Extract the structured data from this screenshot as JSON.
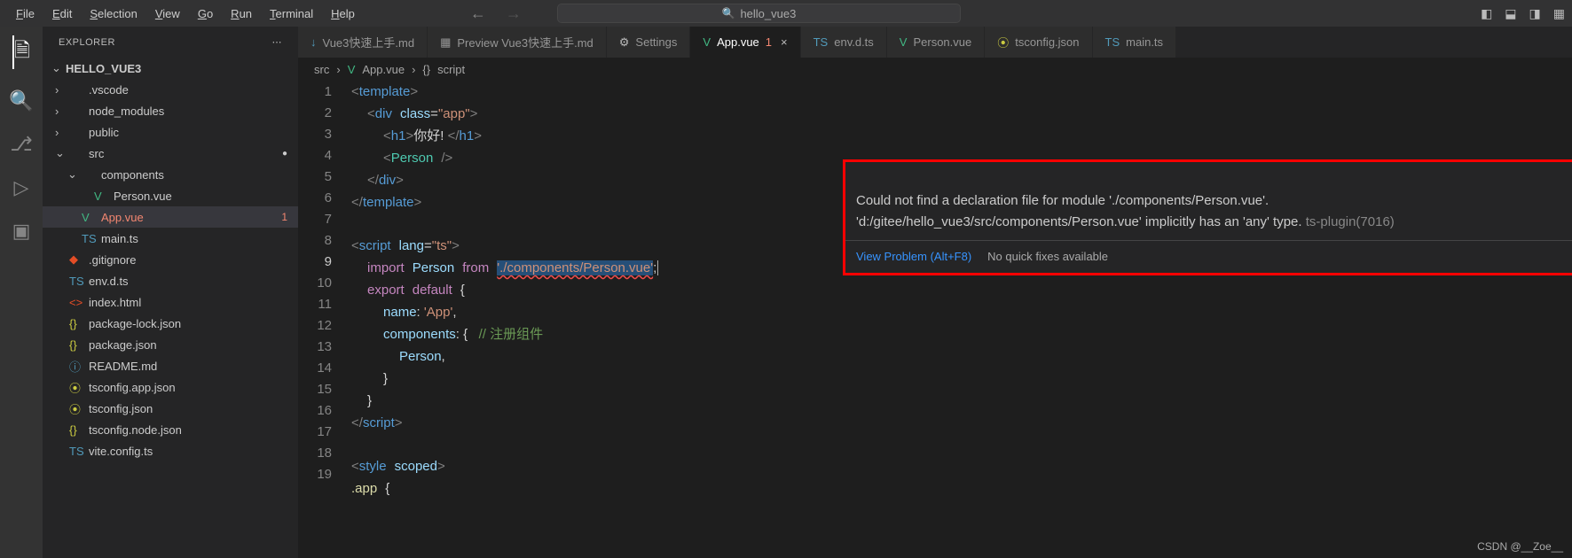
{
  "menu": [
    "File",
    "Edit",
    "Selection",
    "View",
    "Go",
    "Run",
    "Terminal",
    "Help"
  ],
  "search": {
    "text": "hello_vue3"
  },
  "sidebar": {
    "title": "EXPLORER",
    "project": "HELLO_VUE3",
    "tree": [
      {
        "d": 1,
        "chev": ">",
        "icon": "",
        "lbl": ".vscode"
      },
      {
        "d": 1,
        "chev": ">",
        "icon": "",
        "lbl": "node_modules"
      },
      {
        "d": 1,
        "chev": ">",
        "icon": "",
        "lbl": "public"
      },
      {
        "d": 1,
        "chev": "v",
        "icon": "",
        "lbl": "src",
        "dot": true,
        "cls": "src"
      },
      {
        "d": 2,
        "chev": "v",
        "icon": "",
        "lbl": "components"
      },
      {
        "d": 3,
        "chev": "",
        "icon": "V",
        "iconcls": "vue-ic",
        "lbl": "Person.vue"
      },
      {
        "d": 2,
        "chev": "",
        "icon": "V",
        "iconcls": "vue-ic",
        "lbl": "App.vue",
        "sel": true,
        "err": true,
        "badge": "1"
      },
      {
        "d": 2,
        "chev": "",
        "icon": "TS",
        "iconcls": "ts-ic",
        "lbl": "main.ts"
      },
      {
        "d": 1,
        "chev": "",
        "icon": "◆",
        "iconcls": "git-ic",
        "lbl": ".gitignore"
      },
      {
        "d": 1,
        "chev": "",
        "icon": "TS",
        "iconcls": "ts-ic",
        "lbl": "env.d.ts"
      },
      {
        "d": 1,
        "chev": "",
        "icon": "<>",
        "iconcls": "html-ic",
        "lbl": "index.html"
      },
      {
        "d": 1,
        "chev": "",
        "icon": "{}",
        "iconcls": "json-ic",
        "lbl": "package-lock.json"
      },
      {
        "d": 1,
        "chev": "",
        "icon": "{}",
        "iconcls": "json-ic",
        "lbl": "package.json"
      },
      {
        "d": 1,
        "chev": "",
        "icon": "ⓘ",
        "iconcls": "md-ic",
        "lbl": "README.md"
      },
      {
        "d": 1,
        "chev": "",
        "icon": "⦿",
        "iconcls": "ts2-ic",
        "lbl": "tsconfig.app.json"
      },
      {
        "d": 1,
        "chev": "",
        "icon": "⦿",
        "iconcls": "ts2-ic",
        "lbl": "tsconfig.json"
      },
      {
        "d": 1,
        "chev": "",
        "icon": "{}",
        "iconcls": "json-ic",
        "lbl": "tsconfig.node.json"
      },
      {
        "d": 1,
        "chev": "",
        "icon": "TS",
        "iconcls": "ts-ic",
        "lbl": "vite.config.ts"
      }
    ]
  },
  "tabs": [
    {
      "icon": "↓",
      "iconcls": "md-ic",
      "lbl": "Vue3快速上手.md"
    },
    {
      "icon": "▦",
      "iconcls": "",
      "lbl": "Preview Vue3快速上手.md"
    },
    {
      "icon": "⚙",
      "iconcls": "gear-ic",
      "lbl": "Settings"
    },
    {
      "icon": "V",
      "iconcls": "vue-ic",
      "lbl": "App.vue",
      "active": true,
      "err": "1",
      "close": true
    },
    {
      "icon": "TS",
      "iconcls": "ts-ic",
      "lbl": "env.d.ts"
    },
    {
      "icon": "V",
      "iconcls": "vue-ic",
      "lbl": "Person.vue"
    },
    {
      "icon": "⦿",
      "iconcls": "ts2-ic",
      "lbl": "tsconfig.json"
    },
    {
      "icon": "TS",
      "iconcls": "ts-ic",
      "lbl": "main.ts"
    }
  ],
  "breadcrumb": [
    "src",
    "App.vue",
    "script"
  ],
  "code": {
    "lines": [
      "1",
      "2",
      "3",
      "4",
      "5",
      "6",
      "7",
      "8",
      "9",
      "10",
      "11",
      "12",
      "13",
      "14",
      "15",
      "16",
      "17",
      "18",
      "19"
    ],
    "currentLine": 9,
    "l3_text": "你好! ",
    "l9_str": "'./components/Person.vue'",
    "l11_name": "name",
    "l11_val": "'App'",
    "l12_name": "components",
    "l12_cmt": "// 注册组件",
    "l13_val": "Person"
  },
  "tooltip": {
    "line1": "Could not find a declaration file for module './components/Person.vue'.",
    "line2": "'d:/gitee/hello_vue3/src/components/Person.vue' implicitly has an 'any' type.",
    "src": "ts-plugin(7016)",
    "viewProblem": "View Problem (Alt+F8)",
    "noFix": "No quick fixes available"
  },
  "watermark": "CSDN @__Zoe__"
}
